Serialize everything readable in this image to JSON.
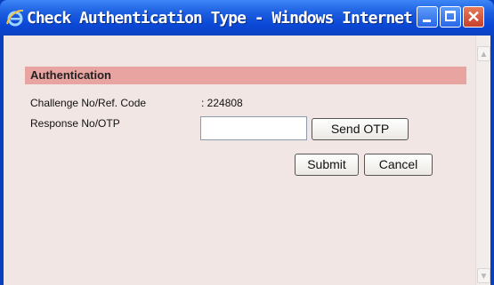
{
  "window": {
    "title": "Check Authentication Type - Windows Internet ..."
  },
  "section": {
    "title": "Authentication"
  },
  "fields": {
    "challenge_label": "Challenge No/Ref. Code",
    "challenge_value": ": 224808",
    "response_label": "Response No/OTP",
    "response_value": ""
  },
  "buttons": {
    "send_otp": "Send OTP",
    "submit": "Submit",
    "cancel": "Cancel"
  },
  "icons": {
    "browser": "ie-icon",
    "minimize": "minimize-icon",
    "maximize": "maximize-icon",
    "close": "close-icon",
    "scroll_up": "scroll-up-icon",
    "scroll_down": "scroll-down-icon"
  },
  "colors": {
    "titlebar": "#1d5fe0",
    "client_bg": "#f2e6e4",
    "section_header": "#e8a4a0"
  }
}
